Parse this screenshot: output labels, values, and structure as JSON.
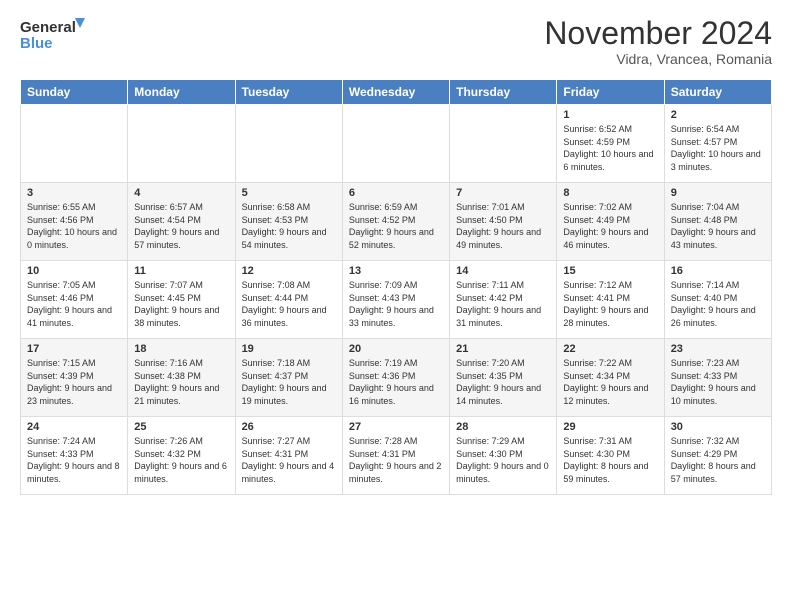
{
  "header": {
    "logo_line1": "General",
    "logo_line2": "Blue",
    "month": "November 2024",
    "location": "Vidra, Vrancea, Romania"
  },
  "days_of_week": [
    "Sunday",
    "Monday",
    "Tuesday",
    "Wednesday",
    "Thursday",
    "Friday",
    "Saturday"
  ],
  "weeks": [
    [
      {
        "day": "",
        "info": ""
      },
      {
        "day": "",
        "info": ""
      },
      {
        "day": "",
        "info": ""
      },
      {
        "day": "",
        "info": ""
      },
      {
        "day": "",
        "info": ""
      },
      {
        "day": "1",
        "info": "Sunrise: 6:52 AM\nSunset: 4:59 PM\nDaylight: 10 hours and 6 minutes."
      },
      {
        "day": "2",
        "info": "Sunrise: 6:54 AM\nSunset: 4:57 PM\nDaylight: 10 hours and 3 minutes."
      }
    ],
    [
      {
        "day": "3",
        "info": "Sunrise: 6:55 AM\nSunset: 4:56 PM\nDaylight: 10 hours and 0 minutes."
      },
      {
        "day": "4",
        "info": "Sunrise: 6:57 AM\nSunset: 4:54 PM\nDaylight: 9 hours and 57 minutes."
      },
      {
        "day": "5",
        "info": "Sunrise: 6:58 AM\nSunset: 4:53 PM\nDaylight: 9 hours and 54 minutes."
      },
      {
        "day": "6",
        "info": "Sunrise: 6:59 AM\nSunset: 4:52 PM\nDaylight: 9 hours and 52 minutes."
      },
      {
        "day": "7",
        "info": "Sunrise: 7:01 AM\nSunset: 4:50 PM\nDaylight: 9 hours and 49 minutes."
      },
      {
        "day": "8",
        "info": "Sunrise: 7:02 AM\nSunset: 4:49 PM\nDaylight: 9 hours and 46 minutes."
      },
      {
        "day": "9",
        "info": "Sunrise: 7:04 AM\nSunset: 4:48 PM\nDaylight: 9 hours and 43 minutes."
      }
    ],
    [
      {
        "day": "10",
        "info": "Sunrise: 7:05 AM\nSunset: 4:46 PM\nDaylight: 9 hours and 41 minutes."
      },
      {
        "day": "11",
        "info": "Sunrise: 7:07 AM\nSunset: 4:45 PM\nDaylight: 9 hours and 38 minutes."
      },
      {
        "day": "12",
        "info": "Sunrise: 7:08 AM\nSunset: 4:44 PM\nDaylight: 9 hours and 36 minutes."
      },
      {
        "day": "13",
        "info": "Sunrise: 7:09 AM\nSunset: 4:43 PM\nDaylight: 9 hours and 33 minutes."
      },
      {
        "day": "14",
        "info": "Sunrise: 7:11 AM\nSunset: 4:42 PM\nDaylight: 9 hours and 31 minutes."
      },
      {
        "day": "15",
        "info": "Sunrise: 7:12 AM\nSunset: 4:41 PM\nDaylight: 9 hours and 28 minutes."
      },
      {
        "day": "16",
        "info": "Sunrise: 7:14 AM\nSunset: 4:40 PM\nDaylight: 9 hours and 26 minutes."
      }
    ],
    [
      {
        "day": "17",
        "info": "Sunrise: 7:15 AM\nSunset: 4:39 PM\nDaylight: 9 hours and 23 minutes."
      },
      {
        "day": "18",
        "info": "Sunrise: 7:16 AM\nSunset: 4:38 PM\nDaylight: 9 hours and 21 minutes."
      },
      {
        "day": "19",
        "info": "Sunrise: 7:18 AM\nSunset: 4:37 PM\nDaylight: 9 hours and 19 minutes."
      },
      {
        "day": "20",
        "info": "Sunrise: 7:19 AM\nSunset: 4:36 PM\nDaylight: 9 hours and 16 minutes."
      },
      {
        "day": "21",
        "info": "Sunrise: 7:20 AM\nSunset: 4:35 PM\nDaylight: 9 hours and 14 minutes."
      },
      {
        "day": "22",
        "info": "Sunrise: 7:22 AM\nSunset: 4:34 PM\nDaylight: 9 hours and 12 minutes."
      },
      {
        "day": "23",
        "info": "Sunrise: 7:23 AM\nSunset: 4:33 PM\nDaylight: 9 hours and 10 minutes."
      }
    ],
    [
      {
        "day": "24",
        "info": "Sunrise: 7:24 AM\nSunset: 4:33 PM\nDaylight: 9 hours and 8 minutes."
      },
      {
        "day": "25",
        "info": "Sunrise: 7:26 AM\nSunset: 4:32 PM\nDaylight: 9 hours and 6 minutes."
      },
      {
        "day": "26",
        "info": "Sunrise: 7:27 AM\nSunset: 4:31 PM\nDaylight: 9 hours and 4 minutes."
      },
      {
        "day": "27",
        "info": "Sunrise: 7:28 AM\nSunset: 4:31 PM\nDaylight: 9 hours and 2 minutes."
      },
      {
        "day": "28",
        "info": "Sunrise: 7:29 AM\nSunset: 4:30 PM\nDaylight: 9 hours and 0 minutes."
      },
      {
        "day": "29",
        "info": "Sunrise: 7:31 AM\nSunset: 4:30 PM\nDaylight: 8 hours and 59 minutes."
      },
      {
        "day": "30",
        "info": "Sunrise: 7:32 AM\nSunset: 4:29 PM\nDaylight: 8 hours and 57 minutes."
      }
    ]
  ]
}
